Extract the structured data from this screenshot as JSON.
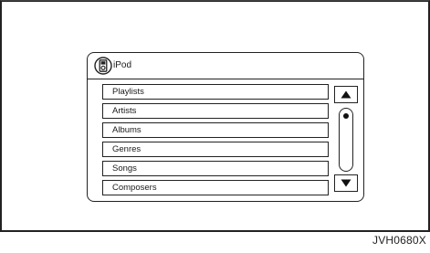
{
  "screen": {
    "title": "iPod",
    "icon": "ipod-icon"
  },
  "menu": {
    "items": [
      {
        "label": "Playlists"
      },
      {
        "label": "Artists"
      },
      {
        "label": "Albums"
      },
      {
        "label": "Genres"
      },
      {
        "label": "Songs"
      },
      {
        "label": "Composers"
      }
    ]
  },
  "scrollbar": {
    "up_icon": "triangle-up-icon",
    "down_icon": "triangle-down-icon",
    "position": 0.0
  },
  "footer": {
    "code": "JVH0680X"
  },
  "colors": {
    "line": "#222222",
    "background": "#ffffff"
  }
}
